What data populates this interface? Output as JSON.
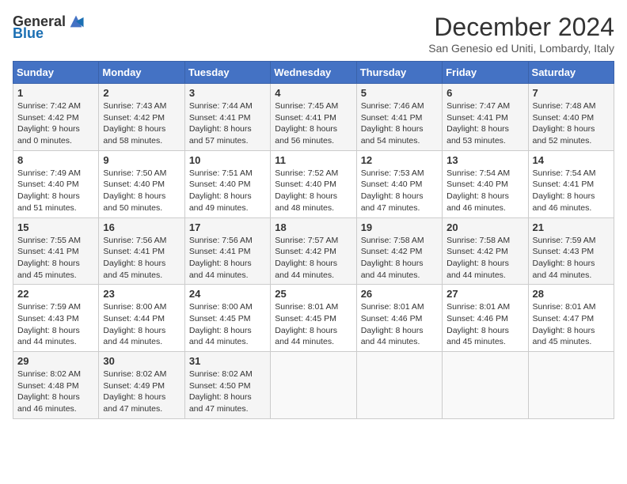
{
  "logo": {
    "general": "General",
    "blue": "Blue"
  },
  "title": "December 2024",
  "subtitle": "San Genesio ed Uniti, Lombardy, Italy",
  "days_of_week": [
    "Sunday",
    "Monday",
    "Tuesday",
    "Wednesday",
    "Thursday",
    "Friday",
    "Saturday"
  ],
  "weeks": [
    [
      {
        "day": "1",
        "sunrise": "7:42 AM",
        "sunset": "4:42 PM",
        "daylight": "9 hours and 0 minutes."
      },
      {
        "day": "2",
        "sunrise": "7:43 AM",
        "sunset": "4:42 PM",
        "daylight": "8 hours and 58 minutes."
      },
      {
        "day": "3",
        "sunrise": "7:44 AM",
        "sunset": "4:41 PM",
        "daylight": "8 hours and 57 minutes."
      },
      {
        "day": "4",
        "sunrise": "7:45 AM",
        "sunset": "4:41 PM",
        "daylight": "8 hours and 56 minutes."
      },
      {
        "day": "5",
        "sunrise": "7:46 AM",
        "sunset": "4:41 PM",
        "daylight": "8 hours and 54 minutes."
      },
      {
        "day": "6",
        "sunrise": "7:47 AM",
        "sunset": "4:41 PM",
        "daylight": "8 hours and 53 minutes."
      },
      {
        "day": "7",
        "sunrise": "7:48 AM",
        "sunset": "4:40 PM",
        "daylight": "8 hours and 52 minutes."
      }
    ],
    [
      {
        "day": "8",
        "sunrise": "7:49 AM",
        "sunset": "4:40 PM",
        "daylight": "8 hours and 51 minutes."
      },
      {
        "day": "9",
        "sunrise": "7:50 AM",
        "sunset": "4:40 PM",
        "daylight": "8 hours and 50 minutes."
      },
      {
        "day": "10",
        "sunrise": "7:51 AM",
        "sunset": "4:40 PM",
        "daylight": "8 hours and 49 minutes."
      },
      {
        "day": "11",
        "sunrise": "7:52 AM",
        "sunset": "4:40 PM",
        "daylight": "8 hours and 48 minutes."
      },
      {
        "day": "12",
        "sunrise": "7:53 AM",
        "sunset": "4:40 PM",
        "daylight": "8 hours and 47 minutes."
      },
      {
        "day": "13",
        "sunrise": "7:54 AM",
        "sunset": "4:40 PM",
        "daylight": "8 hours and 46 minutes."
      },
      {
        "day": "14",
        "sunrise": "7:54 AM",
        "sunset": "4:41 PM",
        "daylight": "8 hours and 46 minutes."
      }
    ],
    [
      {
        "day": "15",
        "sunrise": "7:55 AM",
        "sunset": "4:41 PM",
        "daylight": "8 hours and 45 minutes."
      },
      {
        "day": "16",
        "sunrise": "7:56 AM",
        "sunset": "4:41 PM",
        "daylight": "8 hours and 45 minutes."
      },
      {
        "day": "17",
        "sunrise": "7:56 AM",
        "sunset": "4:41 PM",
        "daylight": "8 hours and 44 minutes."
      },
      {
        "day": "18",
        "sunrise": "7:57 AM",
        "sunset": "4:42 PM",
        "daylight": "8 hours and 44 minutes."
      },
      {
        "day": "19",
        "sunrise": "7:58 AM",
        "sunset": "4:42 PM",
        "daylight": "8 hours and 44 minutes."
      },
      {
        "day": "20",
        "sunrise": "7:58 AM",
        "sunset": "4:42 PM",
        "daylight": "8 hours and 44 minutes."
      },
      {
        "day": "21",
        "sunrise": "7:59 AM",
        "sunset": "4:43 PM",
        "daylight": "8 hours and 44 minutes."
      }
    ],
    [
      {
        "day": "22",
        "sunrise": "7:59 AM",
        "sunset": "4:43 PM",
        "daylight": "8 hours and 44 minutes."
      },
      {
        "day": "23",
        "sunrise": "8:00 AM",
        "sunset": "4:44 PM",
        "daylight": "8 hours and 44 minutes."
      },
      {
        "day": "24",
        "sunrise": "8:00 AM",
        "sunset": "4:45 PM",
        "daylight": "8 hours and 44 minutes."
      },
      {
        "day": "25",
        "sunrise": "8:01 AM",
        "sunset": "4:45 PM",
        "daylight": "8 hours and 44 minutes."
      },
      {
        "day": "26",
        "sunrise": "8:01 AM",
        "sunset": "4:46 PM",
        "daylight": "8 hours and 44 minutes."
      },
      {
        "day": "27",
        "sunrise": "8:01 AM",
        "sunset": "4:46 PM",
        "daylight": "8 hours and 45 minutes."
      },
      {
        "day": "28",
        "sunrise": "8:01 AM",
        "sunset": "4:47 PM",
        "daylight": "8 hours and 45 minutes."
      }
    ],
    [
      {
        "day": "29",
        "sunrise": "8:02 AM",
        "sunset": "4:48 PM",
        "daylight": "8 hours and 46 minutes."
      },
      {
        "day": "30",
        "sunrise": "8:02 AM",
        "sunset": "4:49 PM",
        "daylight": "8 hours and 47 minutes."
      },
      {
        "day": "31",
        "sunrise": "8:02 AM",
        "sunset": "4:50 PM",
        "daylight": "8 hours and 47 minutes."
      },
      null,
      null,
      null,
      null
    ]
  ],
  "labels": {
    "sunrise": "Sunrise:",
    "sunset": "Sunset:",
    "daylight": "Daylight:"
  }
}
